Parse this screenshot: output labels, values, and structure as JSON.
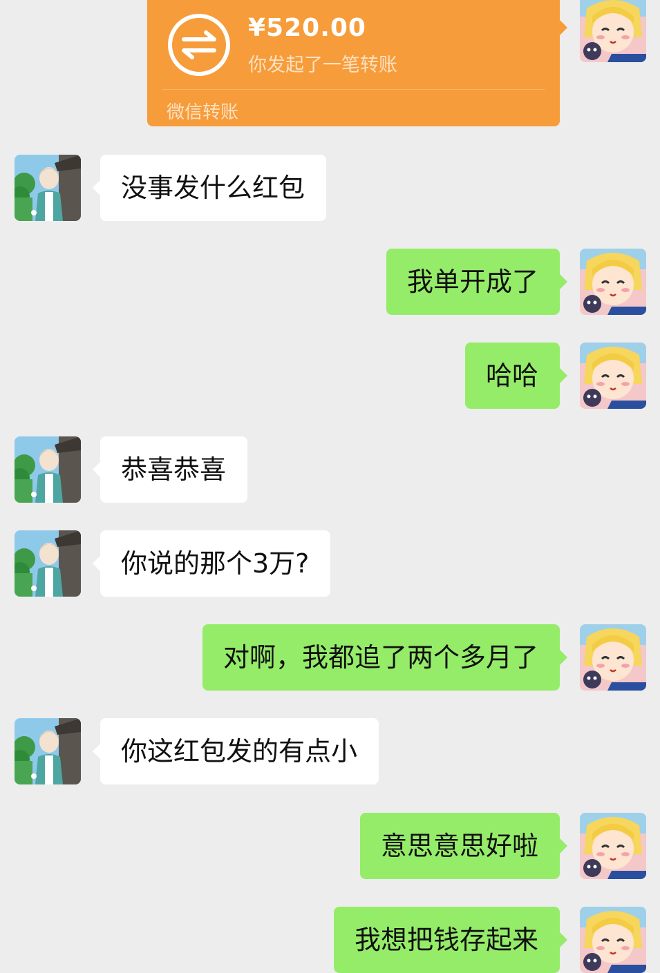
{
  "transfer": {
    "amount": "¥520.00",
    "description": "你发起了一笔转账",
    "footer": "微信转账"
  },
  "messages": [
    {
      "side": "other",
      "text": "没事发什么红包"
    },
    {
      "side": "me",
      "text": "我单开成了"
    },
    {
      "side": "me",
      "text": "哈哈"
    },
    {
      "side": "other",
      "text": "恭喜恭喜"
    },
    {
      "side": "other",
      "text": "你说的那个3万?"
    },
    {
      "side": "me",
      "text": "对啊，我都追了两个多月了"
    },
    {
      "side": "other",
      "text": "你这红包发的有点小"
    },
    {
      "side": "me",
      "text": "意思意思好啦"
    },
    {
      "side": "me",
      "text": "我想把钱存起来"
    }
  ],
  "colors": {
    "background": "#ededed",
    "my_bubble": "#95ec69",
    "other_bubble": "#ffffff",
    "transfer_card": "#f79c3a"
  },
  "icons": {
    "transfer": "transfer-arrows-icon",
    "my_avatar": "anime-girl-avatar",
    "other_avatar": "anime-boy-avatar"
  }
}
